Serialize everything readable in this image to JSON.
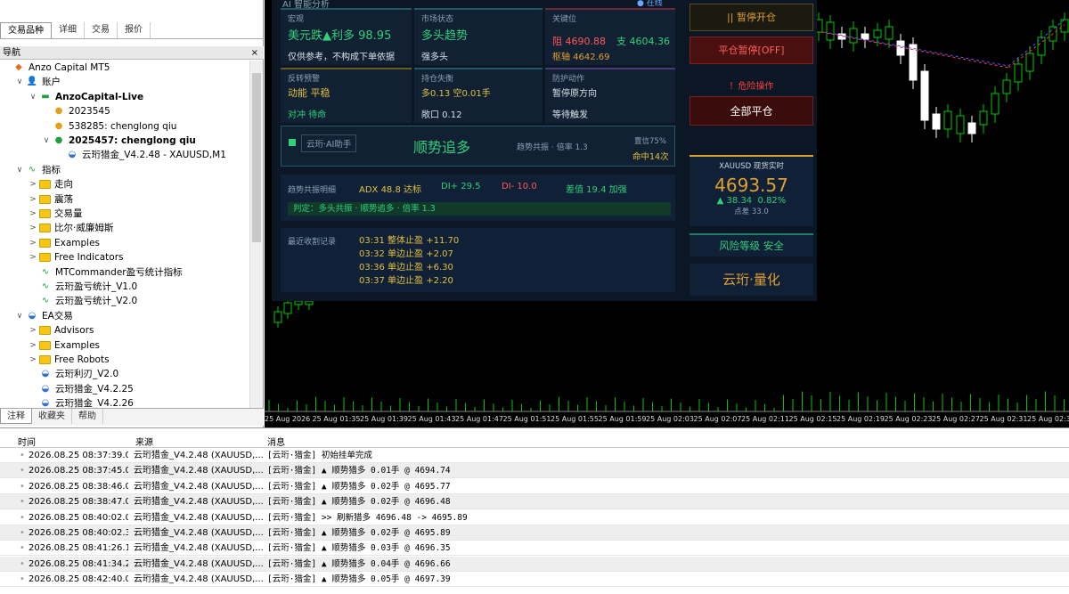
{
  "top_tabs": [
    "交易品种",
    "详细",
    "交易",
    "报价"
  ],
  "navigator": {
    "title": "导航",
    "close": "×"
  },
  "tree": [
    {
      "label": "Anzo Capital MT5",
      "indent": 0,
      "toggle": "",
      "icon": "logo",
      "bold": false
    },
    {
      "label": "账户",
      "indent": 1,
      "toggle": "∨",
      "icon": "accounts",
      "bold": false
    },
    {
      "label": "AnzoCapital-Live",
      "indent": 2,
      "toggle": "∨",
      "icon": "server",
      "bold": true
    },
    {
      "label": "2023545",
      "indent": 3,
      "toggle": "",
      "icon": "user",
      "bold": false
    },
    {
      "label": "538285: chenglong qiu",
      "indent": 3,
      "toggle": "",
      "icon": "user",
      "bold": false
    },
    {
      "label": "2025457: chenglong qiu",
      "indent": 3,
      "toggle": "∨",
      "icon": "user-green",
      "bold": true
    },
    {
      "label": "云珩猎金_V4.2.48 - XAUUSD,M1",
      "indent": 4,
      "toggle": "",
      "icon": "ea",
      "bold": false
    },
    {
      "label": "指标",
      "indent": 1,
      "toggle": "∨",
      "icon": "indicator",
      "bold": false
    },
    {
      "label": "走向",
      "indent": 2,
      "toggle": ">",
      "icon": "folder",
      "bold": false
    },
    {
      "label": "震荡",
      "indent": 2,
      "toggle": ">",
      "icon": "folder",
      "bold": false
    },
    {
      "label": "交易量",
      "indent": 2,
      "toggle": ">",
      "icon": "folder",
      "bold": false
    },
    {
      "label": "比尔·威廉姆斯",
      "indent": 2,
      "toggle": ">",
      "icon": "folder",
      "bold": false
    },
    {
      "label": "Examples",
      "indent": 2,
      "toggle": ">",
      "icon": "folder",
      "bold": false
    },
    {
      "label": "Free Indicators",
      "indent": 2,
      "toggle": ">",
      "icon": "folder",
      "bold": false
    },
    {
      "label": "MTCommander盈亏统计指标",
      "indent": 2,
      "toggle": "",
      "icon": "indicator",
      "bold": false
    },
    {
      "label": "云珩盈亏统计_V1.0",
      "indent": 2,
      "toggle": "",
      "icon": "indicator",
      "bold": false
    },
    {
      "label": "云珩盈亏统计_V2.0",
      "indent": 2,
      "toggle": "",
      "icon": "indicator",
      "bold": false
    },
    {
      "label": "EA交易",
      "indent": 1,
      "toggle": "∨",
      "icon": "ea",
      "bold": false
    },
    {
      "label": "Advisors",
      "indent": 2,
      "toggle": ">",
      "icon": "folder",
      "bold": false
    },
    {
      "label": "Examples",
      "indent": 2,
      "toggle": ">",
      "icon": "folder",
      "bold": false
    },
    {
      "label": "Free Robots",
      "indent": 2,
      "toggle": ">",
      "icon": "folder",
      "bold": false
    },
    {
      "label": "云珩利刃_V2.0",
      "indent": 2,
      "toggle": "",
      "icon": "ea",
      "bold": false
    },
    {
      "label": "云珩猎金_V4.2.25",
      "indent": 2,
      "toggle": "",
      "icon": "ea",
      "bold": false
    },
    {
      "label": "云珩猎金_V4.2.26",
      "indent": 2,
      "toggle": "",
      "icon": "ea",
      "bold": false
    }
  ],
  "bottom_tabs": [
    "注释",
    "收藏夹",
    "帮助"
  ],
  "dashboard": {
    "header": "AI 智能分析",
    "online": "● 在线",
    "macro": {
      "label": "宏观",
      "value": "美元跌▲利多 98.95",
      "note": "仅供参考，不构成下单依据"
    },
    "market": {
      "label": "市场状态",
      "value": "多头趋势",
      "note": "强多头"
    },
    "key": {
      "label": "关键位",
      "resist": "阻 4690.88",
      "support": "支 4604.36",
      "pivot": "枢轴 4642.69"
    },
    "reversal": {
      "label": "反转预警",
      "value": "动能 平稳",
      "note": "对冲 待命"
    },
    "position": {
      "label": "持仓失衡",
      "value": "多0.13 空0.01手",
      "note": "敞口 0.12"
    },
    "defense": {
      "label": "防护动作",
      "value": "暂停原方向",
      "note": "等待触发"
    },
    "assistant": {
      "tag": "云珩·AI助手",
      "mode": "顺势追多",
      "trend": "趋势共振 · 倍率 1.3",
      "conf": "置信75%",
      "hit": "命中14次"
    },
    "resonance": {
      "label": "趋势共振明细",
      "adx": "ADX 48.8 达标",
      "di_plus": "DI+ 29.5",
      "di_minus": "DI- 10.0",
      "diff": "差值 19.4 加强",
      "verdict": "判定：多头共振 · 顺势追多 · 倍率 1.3"
    },
    "recent": {
      "label": "最近收割记录",
      "items": [
        {
          "time": "03:31",
          "text": "整体止盈",
          "val": "+11.70"
        },
        {
          "time": "03:32",
          "text": "单边止盈",
          "val": "+2.07"
        },
        {
          "time": "03:36",
          "text": "单边止盈",
          "val": "+6.30"
        },
        {
          "time": "03:37",
          "text": "单边止盈",
          "val": "+2.20"
        }
      ]
    },
    "btn_pause": "|| 暂停开仓",
    "btn_close_pause": "平仓暂停[OFF]",
    "danger": "！危险操作",
    "btn_close_all": "全部平仓",
    "quote": {
      "title": "XAUUSD 现货实时",
      "price": "4693.57",
      "chg": "▲ 38.34",
      "pct": "0.82%",
      "spread": "点差 33.0"
    },
    "risk": "风险等级  安全",
    "brand": "云珩·量化"
  },
  "xaxis": [
    "25 Aug 2026",
    "25 Aug 01:35",
    "25 Aug 01:39",
    "25 Aug 01:43",
    "25 Aug 01:47",
    "25 Aug 01:51",
    "25 Aug 01:55",
    "25 Aug 01:59",
    "25 Aug 02:03",
    "25 Aug 02:07",
    "25 Aug 02:11",
    "25 Aug 02:15",
    "25 Aug 02:19",
    "25 Aug 02:23",
    "25 Aug 02:27",
    "25 Aug 02:31",
    "25 Aug 02:35"
  ],
  "log": {
    "headers": [
      "时间",
      "来源",
      "消息"
    ],
    "rows": [
      {
        "time": "2026.08.25 08:37:39.0...",
        "src": "云珩猎金_V4.2.48 (XAUUSD,...",
        "msg": "[云珩·猎金] 初始挂单完成"
      },
      {
        "time": "2026.08.25 08:37:45.0...",
        "src": "云珩猎金_V4.2.48 (XAUUSD,...",
        "msg": "[云珩·猎金] ▲ 顺势猎多 0.01手 @ 4694.74"
      },
      {
        "time": "2026.08.25 08:38:46.0...",
        "src": "云珩猎金_V4.2.48 (XAUUSD,...",
        "msg": "[云珩·猎金] ▲ 顺势猎多 0.02手 @ 4695.77"
      },
      {
        "time": "2026.08.25 08:38:47.0...",
        "src": "云珩猎金_V4.2.48 (XAUUSD,...",
        "msg": "[云珩·猎金] ▲ 顺势猎多 0.02手 @ 4696.48"
      },
      {
        "time": "2026.08.25 08:40:02.0...",
        "src": "云珩猎金_V4.2.48 (XAUUSD,...",
        "msg": "[云珩·猎金] >> 刷新猎多 4696.48 -> 4695.89"
      },
      {
        "time": "2026.08.25 08:40:02.3...",
        "src": "云珩猎金_V4.2.48 (XAUUSD,...",
        "msg": "[云珩·猎金] ▲ 顺势猎多 0.02手 @ 4695.89"
      },
      {
        "time": "2026.08.25 08:41:26.1...",
        "src": "云珩猎金_V4.2.48 (XAUUSD,...",
        "msg": "[云珩·猎金] ▲ 顺势猎多 0.03手 @ 4696.35"
      },
      {
        "time": "2026.08.25 08:41:34.2...",
        "src": "云珩猎金_V4.2.48 (XAUUSD,...",
        "msg": "[云珩·猎金] ▲ 顺势猎多 0.04手 @ 4696.66"
      },
      {
        "time": "2026.08.25 08:42:40.0...",
        "src": "云珩猎金_V4.2.48 (XAUUSD,...",
        "msg": "[云珩·猎金] ▲ 顺势猎多 0.05手 @ 4697.39"
      }
    ]
  },
  "colors": {
    "up": "#00c800",
    "down": "#ffffff",
    "panel": "#0b1725",
    "gold": "#e0a030",
    "red": "#ff4040"
  }
}
